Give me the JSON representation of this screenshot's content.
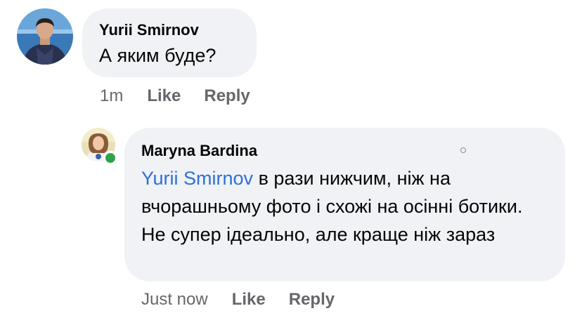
{
  "comment": {
    "author": "Yurii Smirnov",
    "text": "А яким буде?",
    "time": "1m",
    "like_label": "Like",
    "reply_label": "Reply"
  },
  "reply": {
    "author": "Maryna Bardina",
    "mention": "Yurii Smirnov",
    "text": "в рази нижчим, ніж на вчорашньому фото і схожі на осінні ботики. Не супер ідеально, але краще ніж зараз",
    "time": "Just now",
    "like_label": "Like",
    "reply_label": "Reply",
    "online": true
  },
  "colors": {
    "bubble": "#f0f2f5",
    "mention": "#2f6fd6",
    "meta": "#65676b",
    "online": "#31a24c"
  }
}
